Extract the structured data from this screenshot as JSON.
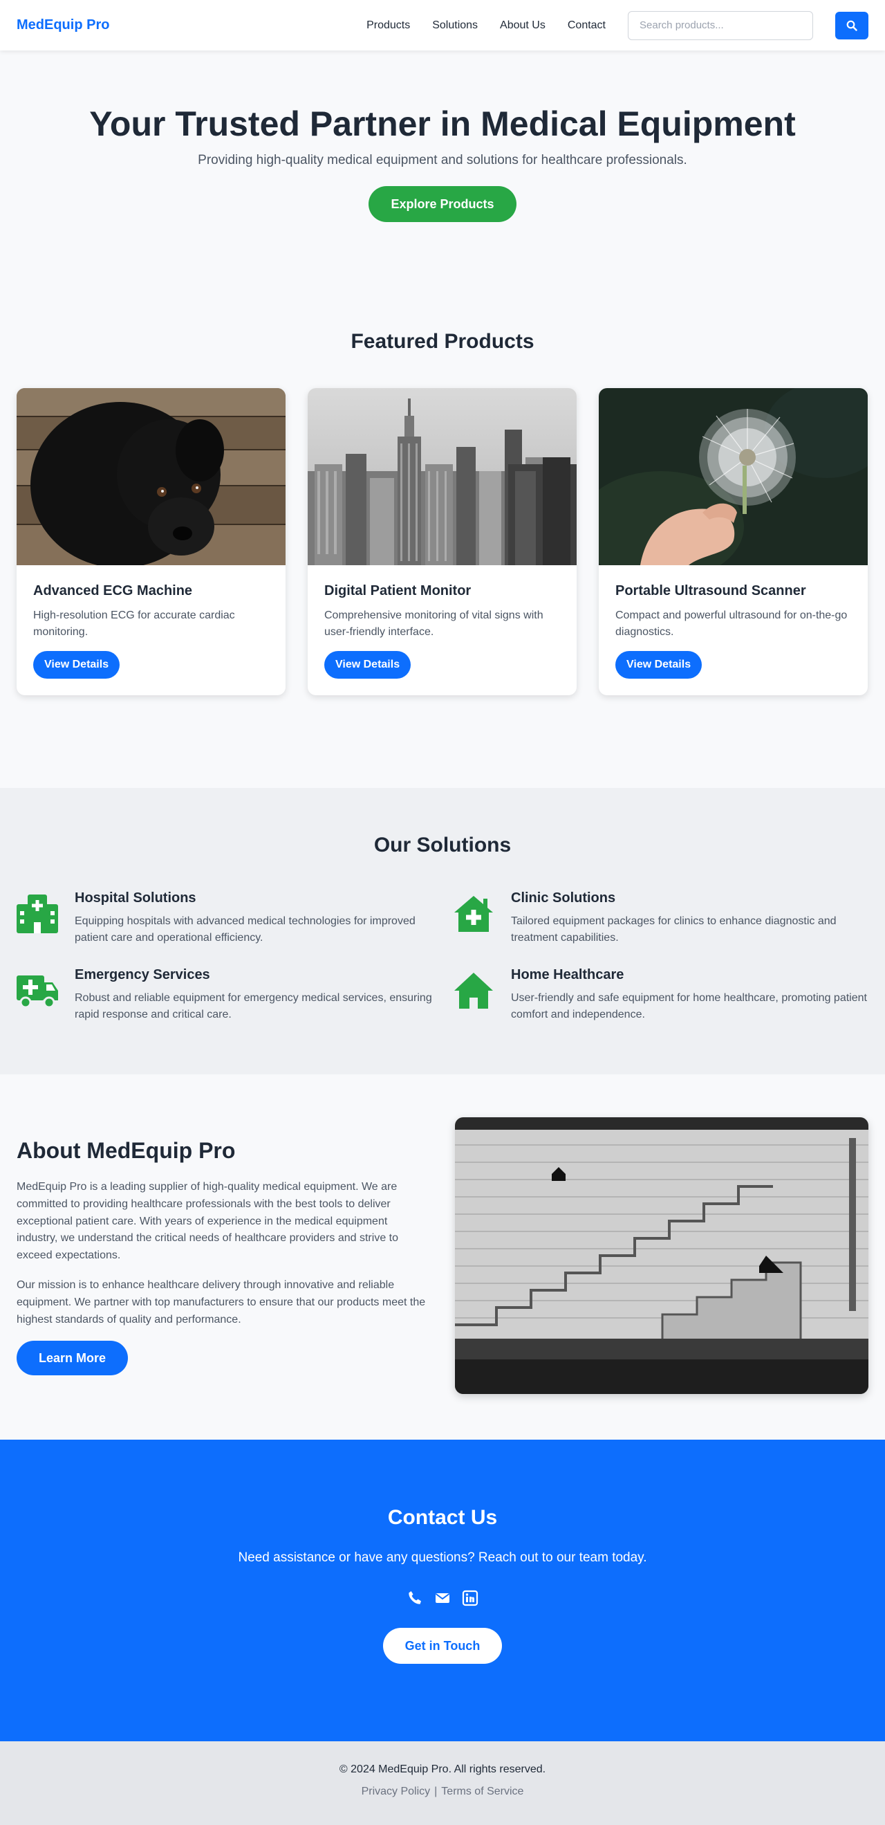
{
  "nav": {
    "logo": "MedEquip Pro",
    "links": [
      "Products",
      "Solutions",
      "About Us",
      "Contact"
    ],
    "search_placeholder": "Search products...",
    "search_icon": "search-icon"
  },
  "hero": {
    "title": "Your Trusted Partner in Medical Equipment",
    "subtitle": "Providing high-quality medical equipment and solutions for healthcare professionals.",
    "cta": "Explore Products"
  },
  "featured": {
    "title": "Featured Products",
    "products": [
      {
        "title": "Advanced ECG Machine",
        "desc": "High-resolution ECG for accurate cardiac monitoring.",
        "cta": "View Details",
        "image": "black puppy on wooden floor"
      },
      {
        "title": "Digital Patient Monitor",
        "desc": "Comprehensive monitoring of vital signs with user-friendly interface.",
        "cta": "View Details",
        "image": "black and white city skyline"
      },
      {
        "title": "Portable Ultrasound Scanner",
        "desc": "Compact and powerful ultrasound for on-the-go diagnostics.",
        "cta": "View Details",
        "image": "hand holding dandelion"
      }
    ]
  },
  "solutions": {
    "title": "Our Solutions",
    "items": [
      {
        "title": "Hospital Solutions",
        "desc": "Equipping hospitals with advanced medical technologies for improved patient care and operational efficiency.",
        "icon": "hospital-icon"
      },
      {
        "title": "Clinic Solutions",
        "desc": "Tailored equipment packages for clinics to enhance diagnostic and treatment capabilities.",
        "icon": "clinic-house-medical-icon"
      },
      {
        "title": "Emergency Services",
        "desc": "Robust and reliable equipment for emergency medical services, ensuring rapid response and critical care.",
        "icon": "ambulance-icon"
      },
      {
        "title": "Home Healthcare",
        "desc": "User-friendly and safe equipment for home healthcare, promoting patient comfort and independence.",
        "icon": "home-icon"
      }
    ],
    "icon_color": "#28a745"
  },
  "about": {
    "title": "About MedEquip Pro",
    "p1": "MedEquip Pro is a leading supplier of high-quality medical equipment. We are committed to providing healthcare professionals with the best tools to deliver exceptional patient care. With years of experience in the medical equipment industry, we understand the critical needs of healthcare providers and strive to exceed expectations.",
    "p2": "Our mission is to enhance healthcare delivery through innovative and reliable equipment. We partner with top manufacturers to ensure that our products meet the highest standards of quality and performance.",
    "cta": "Learn More",
    "image": "black and white stone stairs wall"
  },
  "contact": {
    "title": "Contact Us",
    "text": "Need assistance or have any questions? Reach out to our team today.",
    "icons": [
      "phone-icon",
      "envelope-icon",
      "linkedin-icon"
    ],
    "cta": "Get in Touch"
  },
  "footer": {
    "copyright": "© 2024 MedEquip Pro. All rights reserved.",
    "privacy": "Privacy Policy",
    "separator": "|",
    "terms": "Terms of Service"
  },
  "colors": {
    "primary": "#0d6efd",
    "success": "#28a745",
    "text": "#1f2937"
  }
}
